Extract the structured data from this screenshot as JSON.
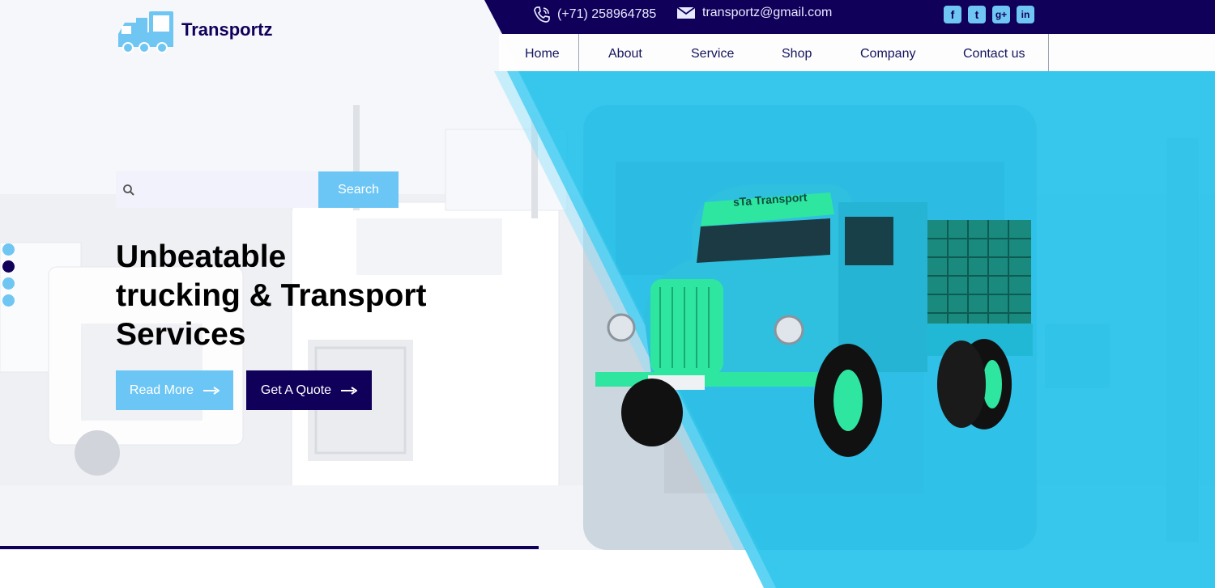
{
  "brand": {
    "name": "Transportz",
    "logo_icon": "truck-icon",
    "color": "#10005a",
    "accent": "#6cc6f5"
  },
  "topbar": {
    "phone": "(+71) 258964785",
    "email": "transportz@gmail.com",
    "socials": [
      {
        "icon": "facebook-icon",
        "glyph": "f"
      },
      {
        "icon": "twitter-icon",
        "glyph": "t"
      },
      {
        "icon": "google-plus-icon",
        "glyph": "g+"
      },
      {
        "icon": "linkedin-icon",
        "glyph": "in"
      }
    ]
  },
  "nav": {
    "items": [
      "Home",
      "About",
      "Service",
      "Shop",
      "Company",
      "Contact us"
    ]
  },
  "search": {
    "placeholder": "",
    "button": "Search"
  },
  "hero": {
    "title_lines": [
      "Unbeatable",
      "trucking & Transport",
      "Services"
    ],
    "read_more": "Read More",
    "get_quote": "Get A Quote",
    "truck_sign": "sTa Transport"
  },
  "slider": {
    "count": 4,
    "active": 2
  }
}
